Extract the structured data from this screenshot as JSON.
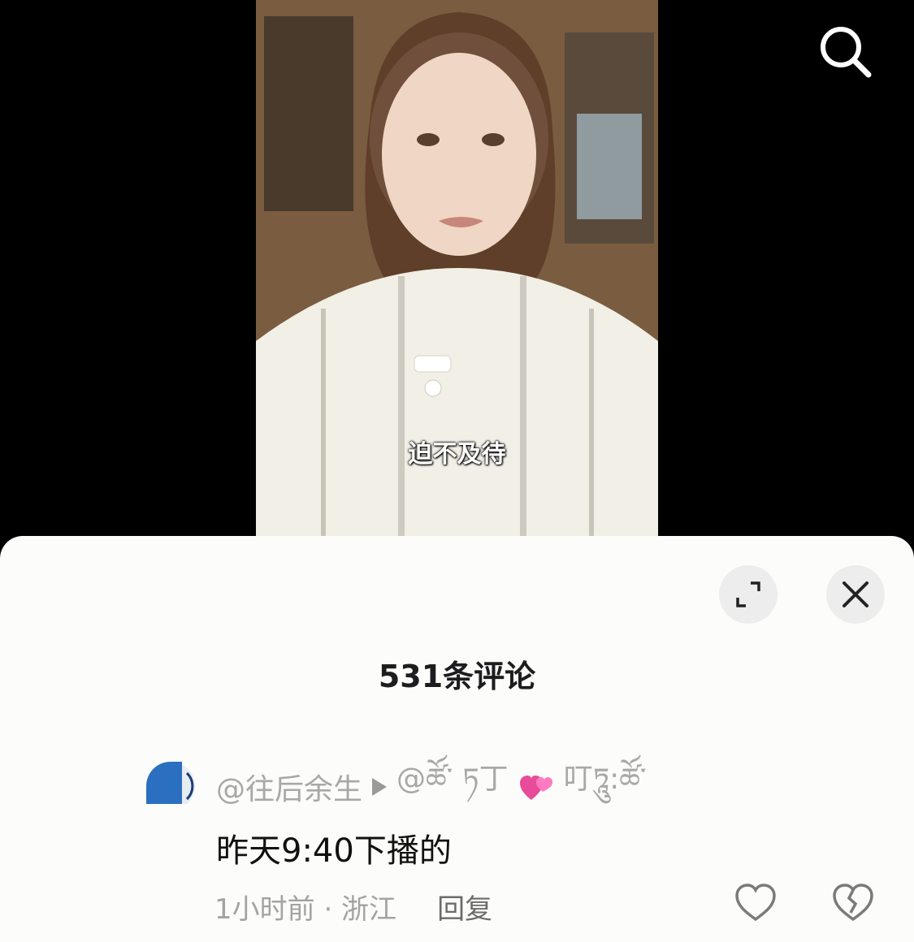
{
  "video": {
    "subtitle": "迫不及待"
  },
  "comments_panel": {
    "count_title": "531条评论",
    "comment": {
      "author": "@往后余生",
      "reply_to_prefix": "@ཚོ་",
      "reply_to_suffix": "ཏ丁",
      "reply_to_end": "叮ཏཱུ:ཚོ་",
      "text": "昨天9:40下播的",
      "time": "1小时前 · 浙江",
      "reply_label": "回复"
    }
  },
  "icons": {
    "search": "search-icon",
    "expand": "expand-icon",
    "close": "close-icon",
    "arrow": "play-arrow-icon",
    "hearts": "two-hearts-emoji",
    "like": "heart-outline-icon",
    "dislike": "broken-heart-icon"
  },
  "colors": {
    "sheet_background": "#fcfcfa",
    "button_background": "#ededed",
    "muted_text": "#a3a3a3"
  }
}
